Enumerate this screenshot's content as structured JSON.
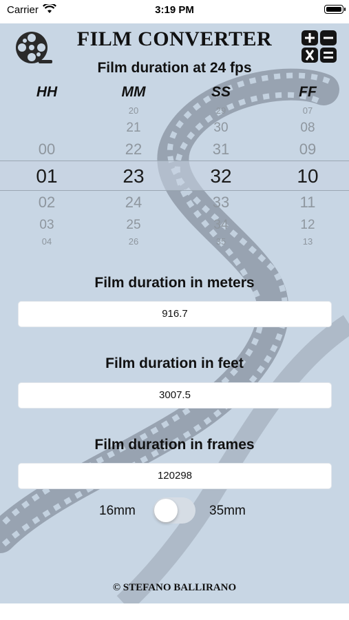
{
  "status_bar": {
    "carrier": "Carrier",
    "time": "3:19 PM"
  },
  "header": {
    "title": "FILM CONVERTER",
    "subtitle": "Film duration at 24 fps"
  },
  "picker": {
    "columns": [
      "HH",
      "MM",
      "SS",
      "FF"
    ],
    "hh": {
      "above": [
        "",
        "",
        "00"
      ],
      "selected": "01",
      "below": [
        "02",
        "03",
        "04"
      ]
    },
    "mm": {
      "above": [
        "20",
        "21",
        "22"
      ],
      "selected": "23",
      "below": [
        "24",
        "25",
        "26"
      ]
    },
    "ss": {
      "above": [
        "29",
        "30",
        "31"
      ],
      "selected": "32",
      "below": [
        "33",
        "34",
        "35"
      ]
    },
    "ff": {
      "above": [
        "07",
        "08",
        "09"
      ],
      "selected": "10",
      "below": [
        "11",
        "12",
        "13"
      ]
    }
  },
  "meters": {
    "label": "Film duration in meters",
    "value": "916.7"
  },
  "feet": {
    "label": "Film duration in feet",
    "value": "3007.5"
  },
  "frames": {
    "label": "Film duration in frames",
    "value": "120298"
  },
  "gauge": {
    "left_label": "16mm",
    "right_label": "35mm",
    "is_35mm": false
  },
  "footer": "© STEFANO BALLIRANO",
  "colors": {
    "background": "#c8d6e4",
    "film_strip": "#8d98a6",
    "text": "#111111"
  }
}
